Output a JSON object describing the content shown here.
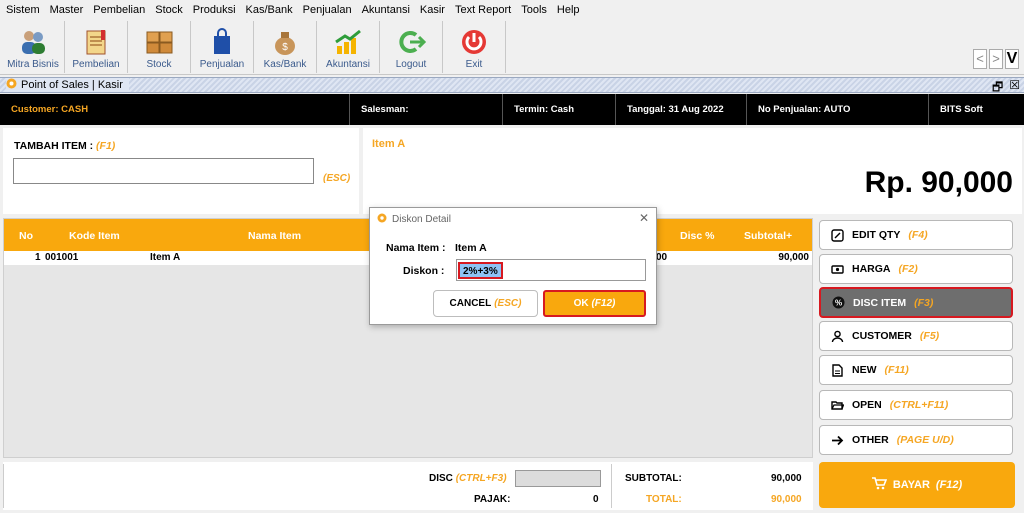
{
  "menu": [
    "Sistem",
    "Master",
    "Pembelian",
    "Stock",
    "Produksi",
    "Kas/Bank",
    "Penjualan",
    "Akuntansi",
    "Kasir",
    "Text Report",
    "Tools",
    "Help"
  ],
  "toolbar": [
    {
      "label": "Mitra Bisnis",
      "icon": "users-icon"
    },
    {
      "label": "Pembelian",
      "icon": "notebook-icon"
    },
    {
      "label": "Stock",
      "icon": "boxes-icon"
    },
    {
      "label": "Penjualan",
      "icon": "shopping-bag-icon"
    },
    {
      "label": "Kas/Bank",
      "icon": "money-bag-icon"
    },
    {
      "label": "Akuntansi",
      "icon": "growth-chart-icon"
    },
    {
      "label": "Logout",
      "icon": "logout-arrow-icon"
    },
    {
      "label": "Exit",
      "icon": "power-icon"
    }
  ],
  "nav": {
    "prev": "<",
    "next": ">",
    "v": "V"
  },
  "window": {
    "title": "Point of Sales | Kasir"
  },
  "info": {
    "customer": "Customer: CASH",
    "salesman": "Salesman:",
    "termin": "Termin: Cash",
    "tanggal": "Tanggal: 31 Aug 2022",
    "no_penjualan": "No Penjualan: AUTO",
    "brand": "BITS Soft"
  },
  "add_item": {
    "title": "TAMBAH ITEM :",
    "shortcut": "(F1)",
    "esc": "(ESC)",
    "value": ""
  },
  "display": {
    "item_name": "Item A",
    "total": "Rp. 90,000"
  },
  "grid": {
    "headers": {
      "no": "No",
      "kode": "Kode Item",
      "nama": "Nama Item",
      "disc": "Disc %",
      "subtotal": "Subtotal+"
    },
    "rows": [
      {
        "no": "1",
        "kode": "001001",
        "nama": "Item A",
        "disc": "00",
        "subtotal": "90,000"
      }
    ]
  },
  "side_buttons": [
    {
      "label": "EDIT QTY",
      "shortcut": "(F4)",
      "icon": "edit-icon",
      "active": false
    },
    {
      "label": "HARGA",
      "shortcut": "(F2)",
      "icon": "price-tag-icon",
      "active": false
    },
    {
      "label": "DISC ITEM",
      "shortcut": "(F3)",
      "icon": "discount-badge-icon",
      "active": true
    },
    {
      "label": "CUSTOMER",
      "shortcut": "(F5)",
      "icon": "customer-icon",
      "active": false
    },
    {
      "label": "NEW",
      "shortcut": "(F11)",
      "icon": "new-document-icon",
      "active": false
    },
    {
      "label": "OPEN",
      "shortcut": "(CTRL+F11)",
      "icon": "folder-open-icon",
      "active": false
    },
    {
      "label": "OTHER",
      "shortcut": "(PAGE U/D)",
      "icon": "arrow-right-icon",
      "active": false
    }
  ],
  "footer": {
    "disc_label": "DISC",
    "disc_shortcut": "(CTRL+F3)",
    "pajak_label": "PAJAK:",
    "pajak_value": "0",
    "subtotal_label": "SUBTOTAL:",
    "subtotal_value": "90,000",
    "total_label": "TOTAL:",
    "total_value": "90,000"
  },
  "pay": {
    "label": "BAYAR",
    "shortcut": "(F12)"
  },
  "dialog": {
    "title": "Diskon Detail",
    "nama_item_label": "Nama Item :",
    "nama_item_value": "Item A",
    "diskon_label": "Diskon :",
    "diskon_value": "2%+3%",
    "cancel_label": "CANCEL",
    "cancel_shortcut": "(ESC)",
    "ok_label": "OK",
    "ok_shortcut": "(F12)"
  },
  "colors": {
    "accent": "#f9a80d",
    "highlight": "#d71920",
    "header_bg": "#000000"
  }
}
